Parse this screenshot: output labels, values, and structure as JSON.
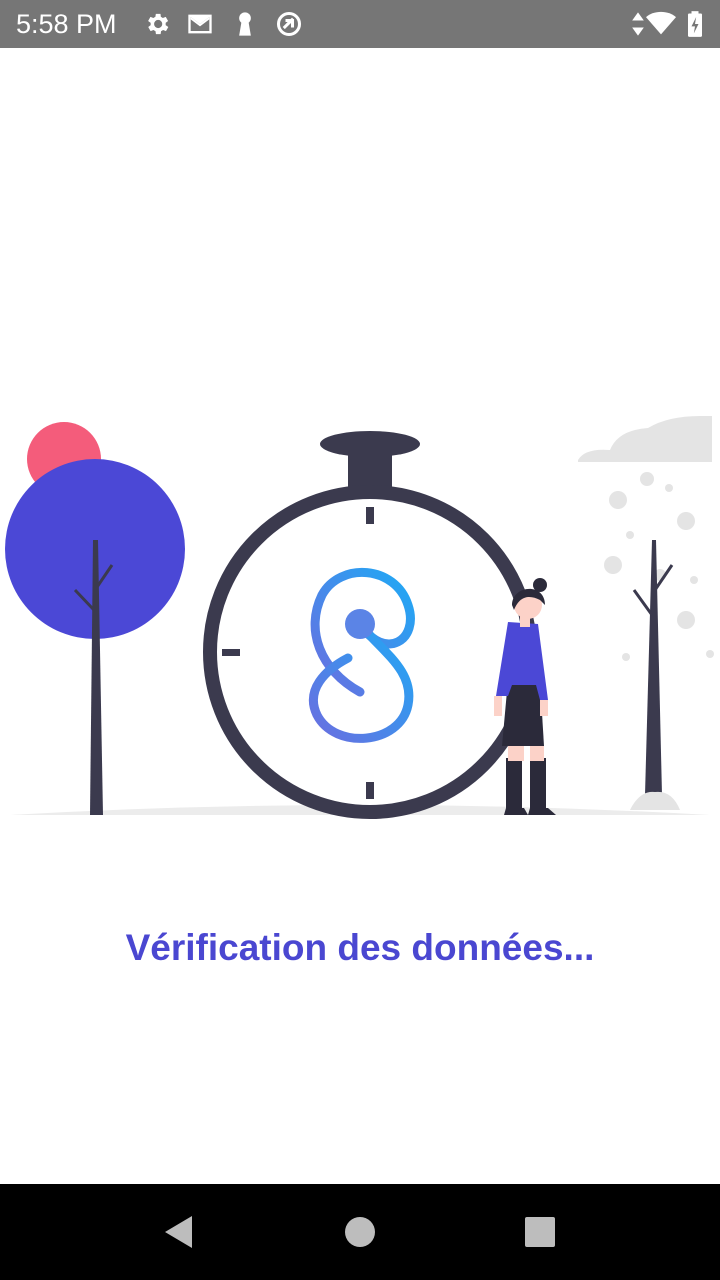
{
  "status_bar": {
    "time": "5:58 PM",
    "background": "#767676",
    "left_icons": [
      "settings-icon",
      "gmail-icon",
      "keyhole-icon",
      "sync-icon"
    ],
    "right_icons": [
      "data-arrows-icon",
      "wifi-icon",
      "battery-charging-icon"
    ]
  },
  "illustration": {
    "accent": "#4b48d6",
    "sun_color": "#f45c7b",
    "dark": "#3b3a4e",
    "logo_gradient": [
      "#6a6ee0",
      "#1eaaf5"
    ]
  },
  "message": {
    "text": "Vérification des données...",
    "color": "#4a47d1"
  },
  "nav_bar": {
    "buttons": [
      "back-icon",
      "home-icon",
      "recents-icon"
    ]
  }
}
